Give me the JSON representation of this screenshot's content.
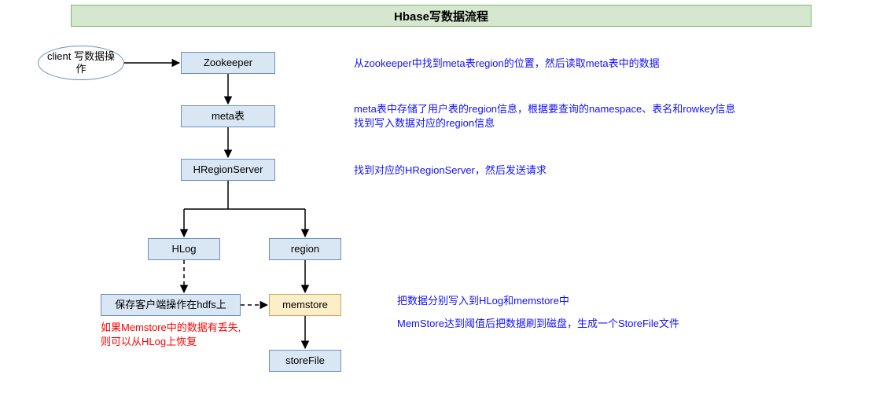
{
  "title": "Hbase写数据流程",
  "nodes": {
    "client": "client\n写数据操作",
    "zookeeper": "Zookeeper",
    "meta": "meta表",
    "hregion": "HRegionServer",
    "hlog": "HLog",
    "region": "region",
    "hdfs_save": "保存客户端操作在hdfs上",
    "memstore": "memstore",
    "storefile": "storeFile"
  },
  "captions": {
    "c1": "从zookeeper中找到meta表region的位置，然后读取meta表中的数据",
    "c2": "meta表中存储了用户表的region信息，根据要查询的namespace、表名和rowkey信息\n找到写入数据对应的region信息",
    "c3": "找到对应的HRegionServer，然后发送请求",
    "c4": "把数据分别写入到HLog和memstore中",
    "c5": "MemStore达到阈值后把数据刷到磁盘，生成一个StoreFile文件"
  },
  "notes": {
    "red1": "如果Memstore中的数据有丢失,\n则可以从HLog上恢复"
  },
  "chart_data": {
    "type": "flowchart",
    "title": "Hbase写数据流程",
    "nodes": [
      {
        "id": "client",
        "label": "client 写数据操作",
        "shape": "ellipse"
      },
      {
        "id": "zookeeper",
        "label": "Zookeeper",
        "shape": "rect"
      },
      {
        "id": "meta",
        "label": "meta表",
        "shape": "rect"
      },
      {
        "id": "hregion",
        "label": "HRegionServer",
        "shape": "rect"
      },
      {
        "id": "hlog",
        "label": "HLog",
        "shape": "rect"
      },
      {
        "id": "region",
        "label": "region",
        "shape": "rect"
      },
      {
        "id": "hdfs_save",
        "label": "保存客户端操作在hdfs上",
        "shape": "rect"
      },
      {
        "id": "memstore",
        "label": "memstore",
        "shape": "rect",
        "color": "orange"
      },
      {
        "id": "storefile",
        "label": "storeFile",
        "shape": "rect"
      }
    ],
    "edges": [
      {
        "from": "client",
        "to": "zookeeper",
        "style": "solid"
      },
      {
        "from": "zookeeper",
        "to": "meta",
        "style": "solid"
      },
      {
        "from": "meta",
        "to": "hregion",
        "style": "solid"
      },
      {
        "from": "hregion",
        "to": "hlog",
        "style": "solid",
        "branch": true
      },
      {
        "from": "hregion",
        "to": "region",
        "style": "solid",
        "branch": true
      },
      {
        "from": "region",
        "to": "memstore",
        "style": "solid"
      },
      {
        "from": "hlog",
        "to": "hdfs_save",
        "style": "dashed"
      },
      {
        "from": "hdfs_save",
        "to": "memstore",
        "style": "dashed"
      },
      {
        "from": "memstore",
        "to": "storefile",
        "style": "solid"
      }
    ],
    "annotations": [
      {
        "at": "zookeeper",
        "text": "从zookeeper中找到meta表region的位置，然后读取meta表中的数据"
      },
      {
        "at": "meta",
        "text": "meta表中存储了用户表的region信息，根据要查询的namespace、表名和rowkey信息找到写入数据对应的region信息"
      },
      {
        "at": "hregion",
        "text": "找到对应的HRegionServer，然后发送请求"
      },
      {
        "at": "memstore",
        "text": "把数据分别写入到HLog和memstore中"
      },
      {
        "at": "storefile",
        "text": "MemStore达到阈值后把数据刷到磁盘，生成一个StoreFile文件"
      },
      {
        "at": "hdfs_save",
        "text": "如果Memstore中的数据有丢失,则可以从HLog上恢复",
        "color": "red"
      }
    ]
  }
}
